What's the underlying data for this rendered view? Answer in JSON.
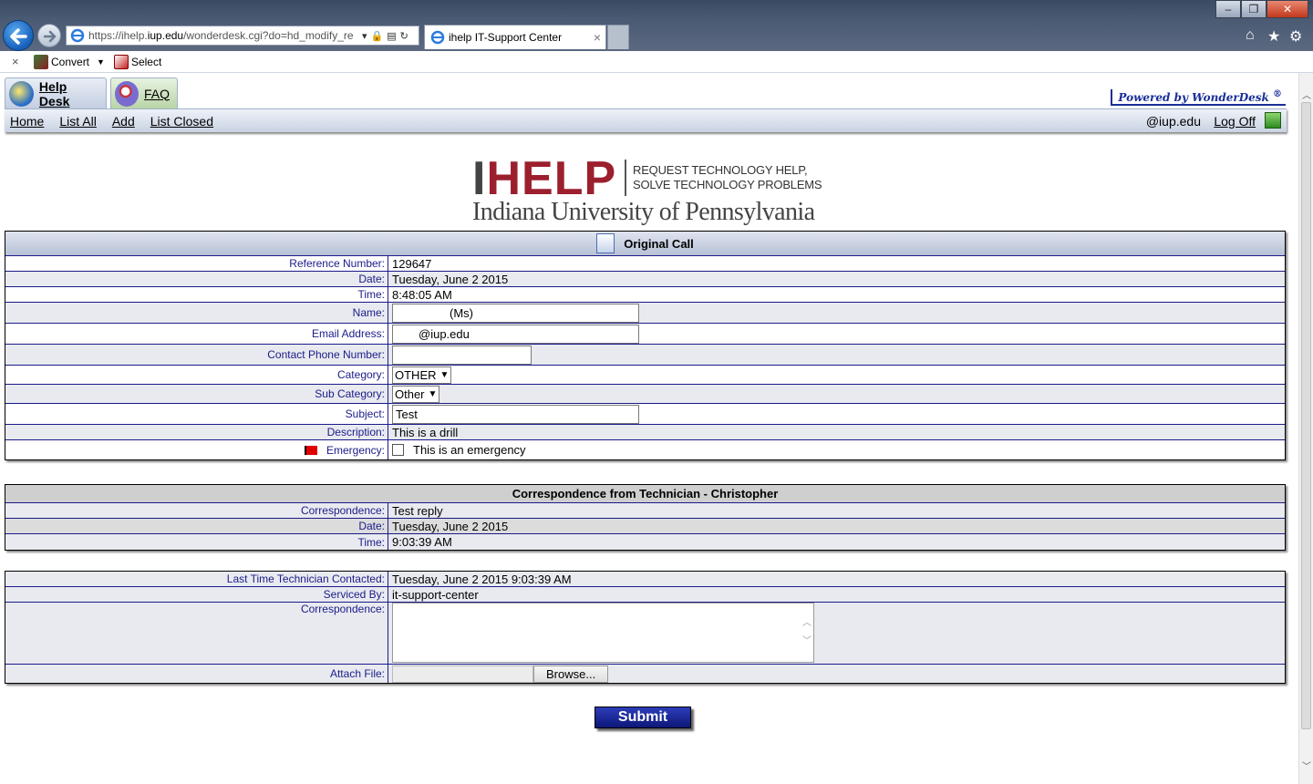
{
  "browser": {
    "url_prefix": "https://ihelp.",
    "url_domain": "iup.edu",
    "url_rest": "/wonderdesk.cgi?do=hd_modify_re",
    "tab_title": "ihelp IT-Support Center",
    "tab_close": "×",
    "win_min": "–",
    "win_max": "❐",
    "win_close": "✕",
    "cmd_close": "×",
    "cmd_convert": "Convert",
    "cmd_select": "Select"
  },
  "app": {
    "tab_helpdesk": "Help Desk",
    "tab_faq": "FAQ",
    "powered_by": "Powered by WonderDesk",
    "powered_reg": "®",
    "nav": [
      "Home",
      "List All",
      "Add",
      "List Closed"
    ],
    "user_email": "@iup.edu",
    "logoff": "Log Off"
  },
  "logo": {
    "letter_i": "I",
    "letters_help": "HELP",
    "tagline_1": "REQUEST TECHNOLOGY HELP,",
    "tagline_2": "SOLVE TECHNOLOGY PROBLEMS",
    "university": "Indiana University of Pennsylvania"
  },
  "original_call": {
    "title": "Original Call",
    "reference_label": "Reference Number:",
    "reference_value": "129647",
    "date_label": "Date:",
    "date_value": "Tuesday, June 2 2015",
    "time_label": "Time:",
    "time_value": "8:48:05 AM",
    "name_label": "Name:",
    "name_value": "(Ms)",
    "email_label": "Email Address:",
    "email_value": "@iup.edu",
    "phone_label": "Contact Phone Number:",
    "phone_value": "",
    "category_label": "Category:",
    "category_value": "OTHER",
    "subcategory_label": "Sub Category:",
    "subcategory_value": "Other",
    "subject_label": "Subject:",
    "subject_value": "Test",
    "description_label": "Description:",
    "description_value": "This is a drill",
    "emergency_label": "Emergency:",
    "emergency_text": "This is an emergency"
  },
  "correspondence": {
    "title": "Correspondence from Technician - Christopher",
    "corr_label": "Correspondence:",
    "corr_value": "Test reply",
    "date_label": "Date:",
    "date_value": "Tuesday, June 2 2015",
    "time_label": "Time:",
    "time_value": "9:03:39 AM"
  },
  "reply": {
    "last_contact_label": "Last Time Technician Contacted:",
    "last_contact_value": "Tuesday, June 2 2015 9:03:39 AM",
    "serviced_label": "Serviced By:",
    "serviced_value": "it-support-center",
    "corr_label": "Correspondence:",
    "attach_label": "Attach File:",
    "browse_label": "Browse...",
    "submit_label": "Submit"
  },
  "colors": {
    "accent": "#1b1b8a",
    "brand_red": "#9c1f2e",
    "submit_blue": "#1a2a9a"
  }
}
